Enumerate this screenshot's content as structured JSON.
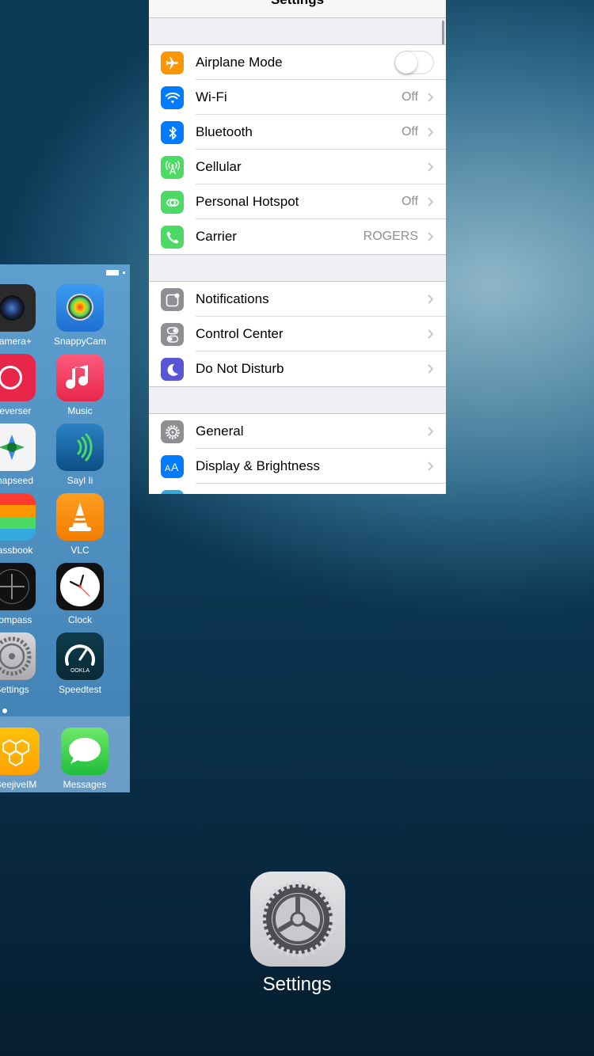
{
  "settings_card": {
    "title": "Settings",
    "groups": [
      {
        "rows": [
          {
            "label": "Airplane Mode",
            "icon": "airplane-icon",
            "color": "#ff9500",
            "toggle": "off"
          },
          {
            "label": "Wi-Fi",
            "value": "Off",
            "icon": "wifi-icon",
            "color": "#007aff"
          },
          {
            "label": "Bluetooth",
            "value": "Off",
            "icon": "bluetooth-icon",
            "color": "#007aff"
          },
          {
            "label": "Cellular",
            "icon": "cellular-antenna-icon",
            "color": "#4cd964"
          },
          {
            "label": "Personal Hotspot",
            "value": "Off",
            "icon": "hotspot-chain-icon",
            "color": "#4cd964"
          },
          {
            "label": "Carrier",
            "value": "ROGERS",
            "icon": "phone-icon",
            "color": "#4cd964"
          }
        ]
      },
      {
        "rows": [
          {
            "label": "Notifications",
            "icon": "notifications-icon",
            "color": "#8e8e93"
          },
          {
            "label": "Control Center",
            "icon": "control-center-icon",
            "color": "#8e8e93"
          },
          {
            "label": "Do Not Disturb",
            "icon": "moon-icon",
            "color": "#5856d6"
          }
        ]
      },
      {
        "rows": [
          {
            "label": "General",
            "icon": "gear-icon",
            "color": "#8e8e93"
          },
          {
            "label": "Display & Brightness",
            "icon": "text-size-icon",
            "color": "#007aff"
          }
        ]
      }
    ]
  },
  "home_screen": {
    "apps": [
      {
        "label": "Camera+",
        "icon": "camera-lens-icon"
      },
      {
        "label": "SnappyCam",
        "icon": "snappycam-icon"
      },
      {
        "label": "Reverser",
        "icon": "reverser-icon"
      },
      {
        "label": "Music",
        "icon": "music-note-icon"
      },
      {
        "label": "Snapseed",
        "icon": "snapseed-icon"
      },
      {
        "label": "Sayl Ii",
        "icon": "soundwave-icon"
      },
      {
        "label": "Passbook",
        "icon": "passbook-icon"
      },
      {
        "label": "VLC",
        "icon": "vlc-cone-icon"
      },
      {
        "label": "Compass",
        "icon": "compass-icon"
      },
      {
        "label": "Clock",
        "icon": "clock-icon"
      },
      {
        "label": "Settings",
        "icon": "gear-icon"
      },
      {
        "label": "Speedtest",
        "icon": "speedometer-icon"
      }
    ],
    "dock": [
      {
        "label": "BeejiveIM",
        "icon": "beejive-hexagon-icon"
      },
      {
        "label": "Messages",
        "icon": "speech-bubble-icon"
      }
    ]
  },
  "app_switcher": {
    "title": "Settings",
    "icon": "gear-icon"
  }
}
